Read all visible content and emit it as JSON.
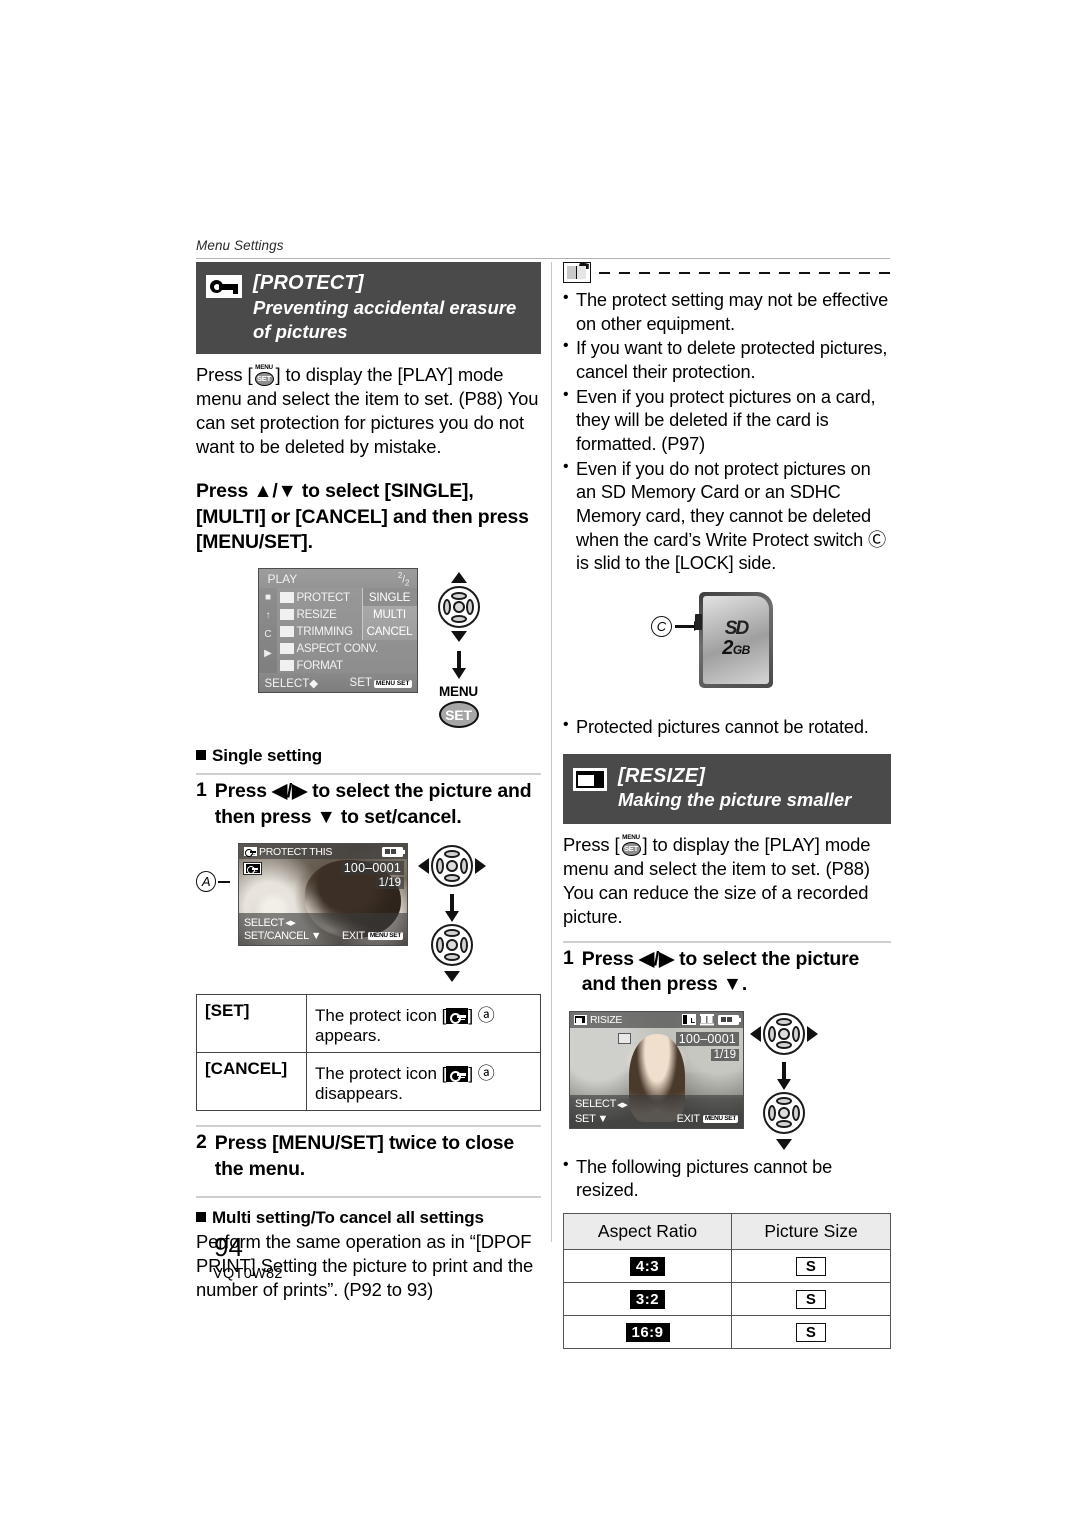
{
  "page": {
    "running_head": "Menu Settings",
    "number": "94",
    "code": "VQT0W82"
  },
  "left_column": {
    "protect_banner": {
      "icon": "key-icon",
      "title": "[PROTECT]",
      "subtitle_line1": "Preventing accidental erasure",
      "subtitle_line2": "of pictures"
    },
    "intro_paragraph_1": "Press [",
    "intro_paragraph_2": "] to display the [PLAY] mode menu and select the item to set. (P88) You can set protection for pictures you do not want to be deleted by mistake.",
    "instruction_1": "Press ▲/▼ to select [SINGLE], [MULTI] or [CANCEL] and then press [MENU/SET].",
    "play_menu_screen": {
      "title": "PLAY",
      "page_indicator_num": "2",
      "page_indicator_den": "2",
      "items": [
        "PROTECT",
        "RESIZE",
        "TRIMMING",
        "ASPECT CONV.",
        "FORMAT"
      ],
      "values": [
        "SINGLE",
        "MULTI",
        "CANCEL"
      ],
      "selected_value": "SINGLE",
      "footer_left": "SELECT",
      "footer_right": "SET",
      "footer_right_badge": "MENU SET"
    },
    "cursor_label_menu": "MENU",
    "cursor_label_set": "SET",
    "single_setting_head": "Single setting",
    "step1_num": "1",
    "step1_text": "Press ◀/▶ to select the picture and then press ▼ to set/cancel.",
    "protect_screen": {
      "title": "PROTECT THIS",
      "file_number": "100–0001",
      "counter": "1/19",
      "footer_select": "SELECT",
      "footer_setcancel": "SET/CANCEL",
      "footer_exit": "EXIT",
      "callout_letter": "A"
    },
    "set_cancel_table": {
      "rows": [
        {
          "key": "[SET]",
          "text_before": "The protect icon [",
          "text_after": "] ⓐ appears.",
          "letter": "A"
        },
        {
          "key": "[CANCEL]",
          "text_before": "The protect icon [",
          "text_after": "] ⓐ disappears.",
          "letter": "A"
        }
      ]
    },
    "step2_num": "2",
    "step2_text": "Press [MENU/SET] twice to close the menu.",
    "multi_setting_head": "Multi setting/To cancel all settings",
    "multi_setting_body": "Perform the same operation as in “[DPOF PRINT] Setting the picture to print and the number of prints”. (P92 to 93)"
  },
  "right_column": {
    "note_bullets": [
      "The protect setting may not be effective on other equipment.",
      "If you want to delete protected pictures, cancel their protection.",
      "Even if you protect pictures on a card, they will be deleted if the card is formatted. (P97)",
      "Even if you do not protect pictures on an SD Memory Card or an SDHC Memory card, they cannot be deleted when the card’s Write Protect switch Ⓒ is slid to the [LOCK] side."
    ],
    "sd_card": {
      "callout_letter": "C",
      "logo": "SD",
      "capacity_number": "2",
      "capacity_unit": "GB"
    },
    "rotate_note": "Protected pictures cannot be rotated.",
    "resize_banner": {
      "icon": "resize-icon",
      "title": "[RESIZE]",
      "subtitle": "Making the picture smaller"
    },
    "resize_intro_1": "Press [",
    "resize_intro_2": "] to display the [PLAY] mode menu and select the item to set. (P88) You can reduce the size of a recorded picture.",
    "resize_step1_num": "1",
    "resize_step1_text": "Press ◀/▶ to select the picture and then press ▼.",
    "resize_screen": {
      "title": "RISIZE",
      "file_number": "100–0001",
      "counter": "1/19",
      "footer_select": "SELECT",
      "footer_set": "SET",
      "footer_exit": "EXIT",
      "picture_size_letter": "L"
    },
    "cannot_resize_note": "The following pictures cannot be resized.",
    "aspect_table": {
      "headers": [
        "Aspect Ratio",
        "Picture Size"
      ],
      "rows": [
        {
          "ratio": "4:3",
          "size": "S"
        },
        {
          "ratio": "3:2",
          "size": "S"
        },
        {
          "ratio": "16:9",
          "size": "S"
        }
      ]
    }
  },
  "colors": {
    "banner_bg": "#4a4a4a",
    "rule": "#b3b3b3",
    "table_header_bg": "#ebebeb"
  }
}
